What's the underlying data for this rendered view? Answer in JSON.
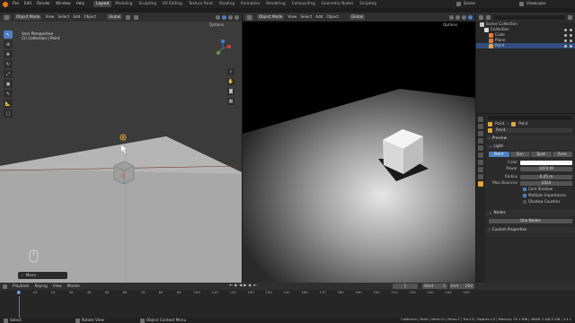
{
  "menu": [
    "File",
    "Edit",
    "Render",
    "Window",
    "Help"
  ],
  "workspaces": [
    "Layout",
    "Modeling",
    "Sculpting",
    "UV Editing",
    "Texture Paint",
    "Shading",
    "Animation",
    "Rendering",
    "Compositing",
    "Geometry Nodes",
    "Scripting"
  ],
  "active_workspace": "Layout",
  "scene": "Scene",
  "view_layer": "ViewLayer",
  "viewport_left": {
    "mode": "Object Mode",
    "menus": [
      "View",
      "Select",
      "Add",
      "Object"
    ],
    "transform": "Global",
    "options": "Options",
    "info_line1": "User Perspective",
    "info_line2": "(1) Collection | Point",
    "last_op": "Move"
  },
  "viewport_right": {
    "mode": "Object Mode",
    "menus": [
      "View",
      "Select",
      "Add",
      "Object"
    ],
    "transform": "Global",
    "options": "Options"
  },
  "outliner": {
    "title": "Scene Collection",
    "items": [
      {
        "name": "Collection",
        "indent": 1
      },
      {
        "name": "Cube",
        "indent": 2
      },
      {
        "name": "Plane",
        "indent": 2
      },
      {
        "name": "Point",
        "indent": 2,
        "selected": true
      }
    ]
  },
  "properties": {
    "breadcrumb_obj": "Point",
    "breadcrumb_data": "Point",
    "data_name": "Point",
    "preview": "Preview",
    "light": "Light",
    "light_types": [
      "Point",
      "Sun",
      "Spot",
      "Area"
    ],
    "active_type": "Point",
    "color_label": "Color",
    "power_label": "Power",
    "power": "1074 W",
    "radius_label": "Radius",
    "radius": "0.25 m",
    "max_bounces_label": "Max Bounces",
    "max_bounces": "1024",
    "cast_shadow": "Cast Shadow",
    "multiple_importance": "Multiple Importance",
    "shadow_caustics": "Shadow Caustics",
    "nodes": "Nodes",
    "use_nodes": "Use Nodes",
    "custom_properties": "Custom Properties"
  },
  "timeline": {
    "menus": [
      "Playback",
      "Keying",
      "View",
      "Marker"
    ],
    "current_frame": "1",
    "start_label": "Start",
    "start": "1",
    "end_label": "End",
    "end": "250",
    "ticks": [
      "1",
      "10",
      "20",
      "30",
      "40",
      "50",
      "60",
      "70",
      "80",
      "90",
      "100",
      "110",
      "120",
      "130",
      "140",
      "150",
      "160",
      "170",
      "180",
      "190",
      "200",
      "210",
      "220",
      "230",
      "240",
      "250"
    ]
  },
  "status": {
    "select": "Select",
    "rotate": "Rotate View",
    "context": "Object Context Menu",
    "stats": "Collection | Point | Verts:12 | Faces:7 | Tris:14 | Objects:1/3 | Memory: 55.1 MiB | VRAM: 0.4/8.0 GiB | 3.4.1"
  },
  "colors": {
    "accent": "#4d7fc4",
    "logo": "#e87d0d"
  }
}
